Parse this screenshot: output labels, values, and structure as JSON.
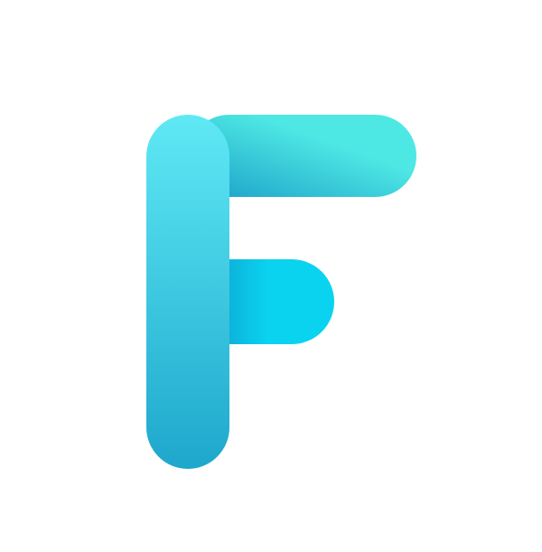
{
  "logo": {
    "letter": "F",
    "colors": {
      "top_bar_dark": "#1a9fc8",
      "top_bar_light": "#4ee8e4",
      "middle_bar_dark": "#0e93c5",
      "middle_bar_light": "#0ad3f0",
      "stem_top": "#5fe9f5",
      "stem_bottom": "#1ea7cc",
      "background": "#ffffff"
    }
  }
}
